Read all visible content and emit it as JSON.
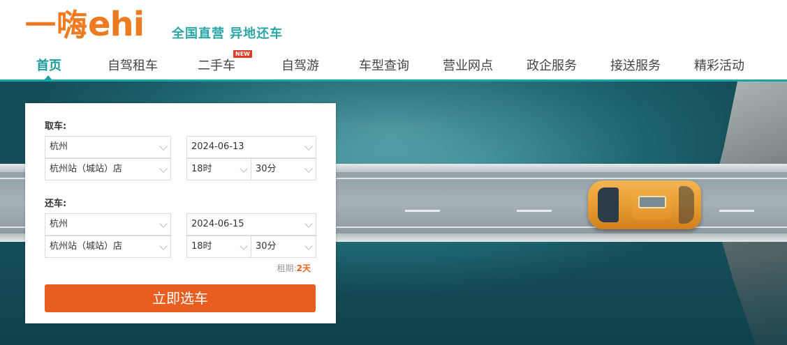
{
  "brand": {
    "logo_text_cn": "一嗨",
    "logo_text_en": "ehi",
    "slogan": "全国直营 异地还车",
    "accent_color": "#1aa5a2",
    "brand_color": "#ee7a22"
  },
  "nav": {
    "items": [
      {
        "label": "首页",
        "active": true
      },
      {
        "label": "自驾租车"
      },
      {
        "label": "二手车",
        "badge": "NEW"
      },
      {
        "label": "自驾游"
      },
      {
        "label": "车型查询"
      },
      {
        "label": "营业网点"
      },
      {
        "label": "政企服务"
      },
      {
        "label": "接送服务"
      },
      {
        "label": "精彩活动"
      }
    ]
  },
  "booking": {
    "pickup": {
      "label": "取车:",
      "city": "杭州",
      "store": "杭州站（城站）店",
      "date": "2024-06-13",
      "hour": "18时",
      "minute": "30分"
    },
    "return": {
      "label": "还车:",
      "city": "杭州",
      "store": "杭州站（城站）店",
      "date": "2024-06-15",
      "hour": "18时",
      "minute": "30分"
    },
    "rent_days_label": "租期:",
    "rent_days_value": "2天",
    "submit_label": "立即选车",
    "submit_color": "#e85e20"
  }
}
